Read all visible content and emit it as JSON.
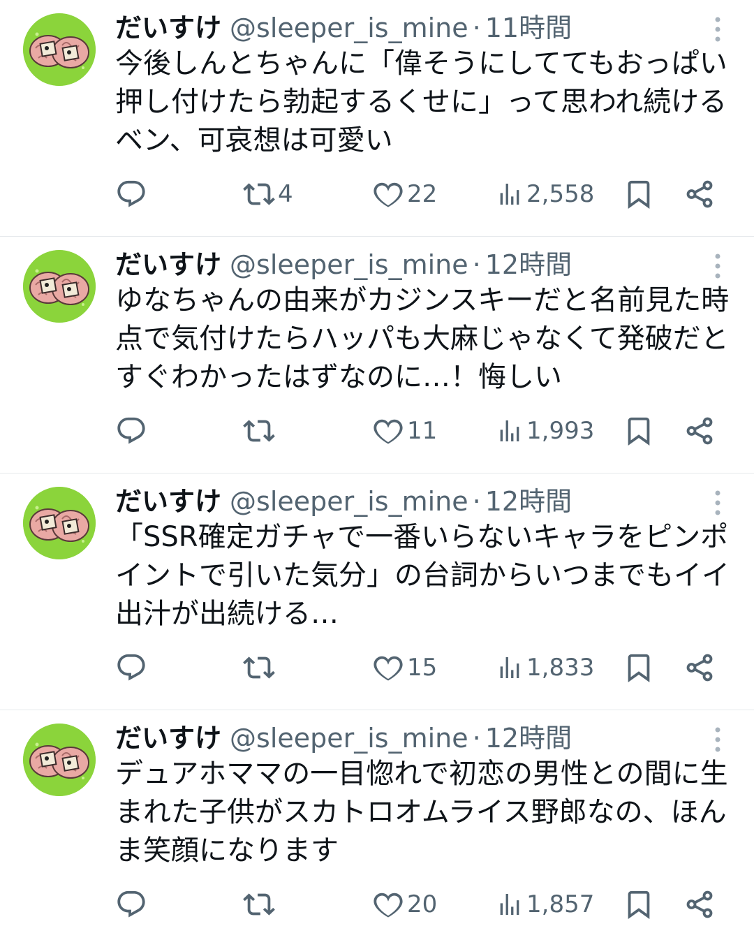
{
  "tweets": [
    {
      "name": "だいすけ",
      "handle": "@sleeper_is_mine",
      "separator": "·",
      "time": "11時間",
      "text": "今後しんとちゃんに「偉そうにしててもおっぱい押し付けたら勃起するくせに」って思われ続けるベン、可哀想は可愛い",
      "retweets": "4",
      "likes": "22",
      "views": "2,558"
    },
    {
      "name": "だいすけ",
      "handle": "@sleeper_is_mine",
      "separator": "·",
      "time": "12時間",
      "text": "ゆなちゃんの由来がカジンスキーだと名前見た時点で気付けたらハッパも大麻じゃなくて発破だとすぐわかったはずなのに…！悔しい",
      "retweets": "",
      "likes": "11",
      "views": "1,993"
    },
    {
      "name": "だいすけ",
      "handle": "@sleeper_is_mine",
      "separator": "·",
      "time": "12時間",
      "text": "「SSR確定ガチャで一番いらないキャラをピンポイントで引いた気分」の台詞からいつまでもイイ出汁が出続ける…",
      "retweets": "",
      "likes": "15",
      "views": "1,833"
    },
    {
      "name": "だいすけ",
      "handle": "@sleeper_is_mine",
      "separator": "·",
      "time": "12時間",
      "text": "デュアホママの一目惚れで初恋の男性との間に生まれた子供がスカトロオムライス野郎なの、ほんま笑顔になります",
      "retweets": "",
      "likes": "20",
      "views": "1,857"
    }
  ],
  "colors": {
    "text": "#0f1419",
    "secondary": "#536471",
    "divider": "#e6e9ec",
    "avatar_bg": "#8bd43b"
  },
  "icons": [
    "reply-icon",
    "retweet-icon",
    "like-icon",
    "views-icon",
    "bookmark-icon",
    "share-icon",
    "more-icon",
    "avatar-brain-image"
  ]
}
